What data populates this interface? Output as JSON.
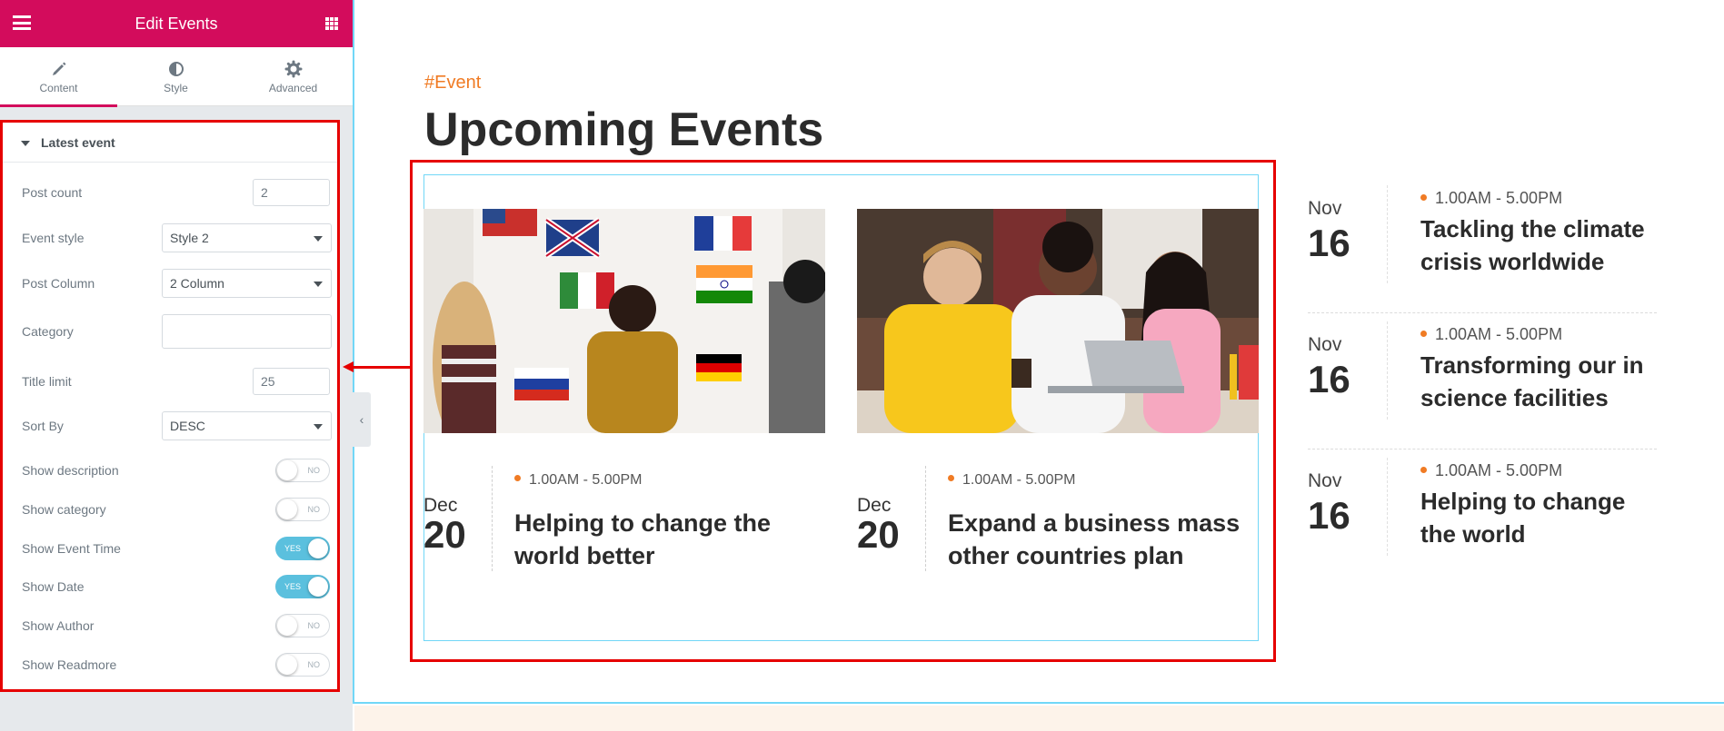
{
  "editor": {
    "title": "Edit Events",
    "tabs": [
      {
        "label": "Content",
        "icon": "pencil-icon"
      },
      {
        "label": "Style",
        "icon": "contrast-icon"
      },
      {
        "label": "Advanced",
        "icon": "gear-icon"
      }
    ],
    "section_title": "Latest event",
    "controls": {
      "post_count": {
        "label": "Post count",
        "value": "2"
      },
      "event_style": {
        "label": "Event style",
        "value": "Style 2"
      },
      "post_column": {
        "label": "Post Column",
        "value": "2 Column"
      },
      "category": {
        "label": "Category",
        "value": ""
      },
      "title_limit": {
        "label": "Title limit",
        "value": "25"
      },
      "sort_by": {
        "label": "Sort By",
        "value": "DESC"
      },
      "show_description": {
        "label": "Show description",
        "state": "NO"
      },
      "show_category": {
        "label": "Show category",
        "state": "NO"
      },
      "show_event_time": {
        "label": "Show Event Time",
        "state": "YES"
      },
      "show_date": {
        "label": "Show Date",
        "state": "YES"
      },
      "show_author": {
        "label": "Show Author",
        "state": "NO"
      },
      "show_readmore": {
        "label": "Show Readmore",
        "state": "NO"
      }
    },
    "collapse_glyph": "‹"
  },
  "preview": {
    "tag": "#Event",
    "heading": "Upcoming Events",
    "cards": [
      {
        "month": "Dec",
        "day": "20",
        "time": "1.00AM - 5.00PM",
        "title": "Helping to change the world better"
      },
      {
        "month": "Dec",
        "day": "20",
        "time": "1.00AM - 5.00PM",
        "title": "Expand a business mass other countries plan"
      }
    ],
    "side_events": [
      {
        "month": "Nov",
        "day": "16",
        "time": "1.00AM - 5.00PM",
        "title": "Tackling the climate crisis worldwide"
      },
      {
        "month": "Nov",
        "day": "16",
        "time": "1.00AM - 5.00PM",
        "title": "Transforming our in science facilities"
      },
      {
        "month": "Nov",
        "day": "16",
        "time": "1.00AM - 5.00PM",
        "title": "Helping to change the world"
      }
    ]
  },
  "colors": {
    "brand": "#d30c5c",
    "accent_orange": "#f07b24",
    "toggle_on": "#5bc0de",
    "highlight_red": "#e60000",
    "frame_blue": "#71d7f7"
  }
}
